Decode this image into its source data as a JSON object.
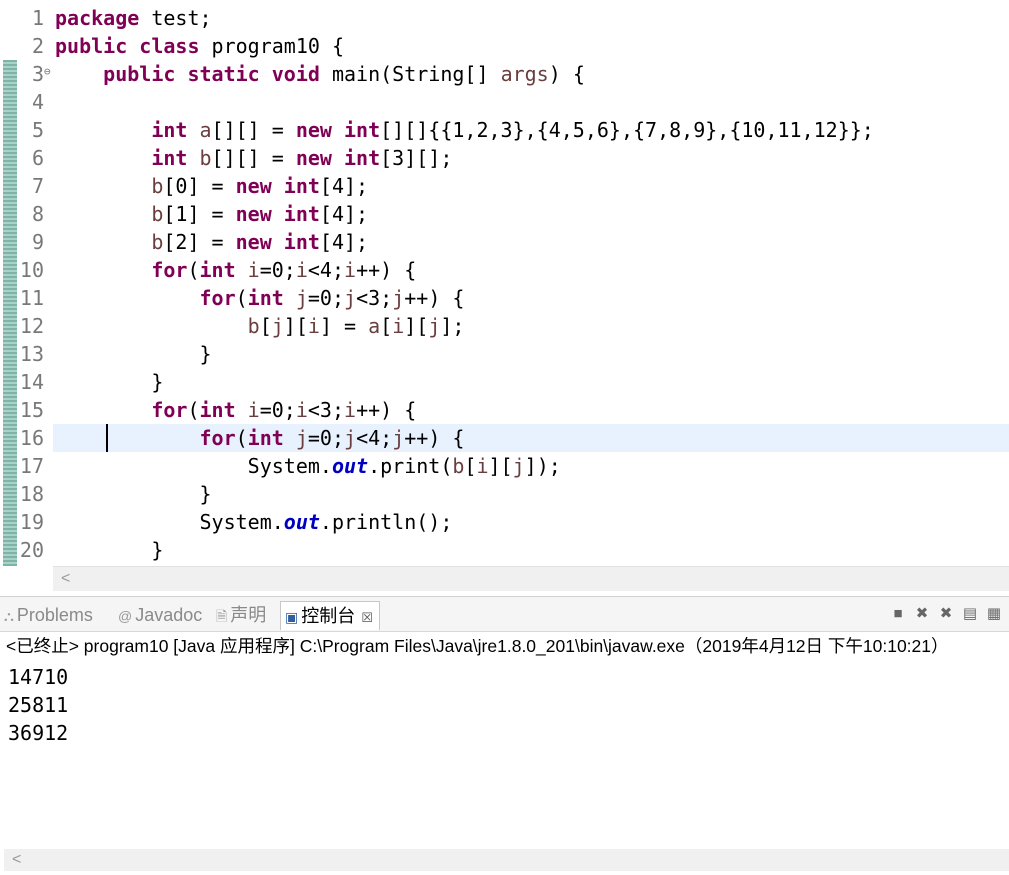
{
  "editor": {
    "lines": [
      {
        "n": "1",
        "tokens": [
          {
            "t": "package",
            "k": "kw"
          },
          {
            "t": " test;"
          }
        ]
      },
      {
        "n": "2",
        "tokens": [
          {
            "t": "public",
            "k": "kw"
          },
          {
            "t": " "
          },
          {
            "t": "class",
            "k": "kw"
          },
          {
            "t": " program10 {"
          }
        ]
      },
      {
        "n": "3",
        "fold": "⊖",
        "tokens": [
          {
            "t": "    "
          },
          {
            "t": "public",
            "k": "kw"
          },
          {
            "t": " "
          },
          {
            "t": "static",
            "k": "kw"
          },
          {
            "t": " "
          },
          {
            "t": "void",
            "k": "kw"
          },
          {
            "t": " main(String[] "
          },
          {
            "t": "args",
            "k": "var"
          },
          {
            "t": ") {"
          }
        ]
      },
      {
        "n": "4",
        "tokens": [
          {
            "t": ""
          }
        ]
      },
      {
        "n": "5",
        "tokens": [
          {
            "t": "        "
          },
          {
            "t": "int",
            "k": "kw"
          },
          {
            "t": " "
          },
          {
            "t": "a",
            "k": "var"
          },
          {
            "t": "[][] = "
          },
          {
            "t": "new",
            "k": "kw"
          },
          {
            "t": " "
          },
          {
            "t": "int",
            "k": "kw"
          },
          {
            "t": "[][]{{1,2,3},{4,5,6},{7,8,9},{10,11,12}};"
          }
        ]
      },
      {
        "n": "6",
        "tokens": [
          {
            "t": "        "
          },
          {
            "t": "int",
            "k": "kw"
          },
          {
            "t": " "
          },
          {
            "t": "b",
            "k": "var"
          },
          {
            "t": "[][] = "
          },
          {
            "t": "new",
            "k": "kw"
          },
          {
            "t": " "
          },
          {
            "t": "int",
            "k": "kw"
          },
          {
            "t": "[3][];"
          }
        ]
      },
      {
        "n": "7",
        "tokens": [
          {
            "t": "        "
          },
          {
            "t": "b",
            "k": "var"
          },
          {
            "t": "[0] = "
          },
          {
            "t": "new",
            "k": "kw"
          },
          {
            "t": " "
          },
          {
            "t": "int",
            "k": "kw"
          },
          {
            "t": "[4];"
          }
        ]
      },
      {
        "n": "8",
        "tokens": [
          {
            "t": "        "
          },
          {
            "t": "b",
            "k": "var"
          },
          {
            "t": "[1] = "
          },
          {
            "t": "new",
            "k": "kw"
          },
          {
            "t": " "
          },
          {
            "t": "int",
            "k": "kw"
          },
          {
            "t": "[4];"
          }
        ]
      },
      {
        "n": "9",
        "tokens": [
          {
            "t": "        "
          },
          {
            "t": "b",
            "k": "var"
          },
          {
            "t": "[2] = "
          },
          {
            "t": "new",
            "k": "kw"
          },
          {
            "t": " "
          },
          {
            "t": "int",
            "k": "kw"
          },
          {
            "t": "[4];"
          }
        ]
      },
      {
        "n": "10",
        "tokens": [
          {
            "t": "        "
          },
          {
            "t": "for",
            "k": "kw"
          },
          {
            "t": "("
          },
          {
            "t": "int",
            "k": "kw"
          },
          {
            "t": " "
          },
          {
            "t": "i",
            "k": "var"
          },
          {
            "t": "=0;"
          },
          {
            "t": "i",
            "k": "var"
          },
          {
            "t": "<4;"
          },
          {
            "t": "i",
            "k": "var"
          },
          {
            "t": "++) {"
          }
        ]
      },
      {
        "n": "11",
        "tokens": [
          {
            "t": "            "
          },
          {
            "t": "for",
            "k": "kw"
          },
          {
            "t": "("
          },
          {
            "t": "int",
            "k": "kw"
          },
          {
            "t": " "
          },
          {
            "t": "j",
            "k": "var"
          },
          {
            "t": "=0;"
          },
          {
            "t": "j",
            "k": "var"
          },
          {
            "t": "<3;"
          },
          {
            "t": "j",
            "k": "var"
          },
          {
            "t": "++) {"
          }
        ]
      },
      {
        "n": "12",
        "tokens": [
          {
            "t": "                "
          },
          {
            "t": "b",
            "k": "var"
          },
          {
            "t": "["
          },
          {
            "t": "j",
            "k": "var"
          },
          {
            "t": "]["
          },
          {
            "t": "i",
            "k": "var"
          },
          {
            "t": "] = "
          },
          {
            "t": "a",
            "k": "var"
          },
          {
            "t": "["
          },
          {
            "t": "i",
            "k": "var"
          },
          {
            "t": "]["
          },
          {
            "t": "j",
            "k": "var"
          },
          {
            "t": "];"
          }
        ]
      },
      {
        "n": "13",
        "tokens": [
          {
            "t": "            }"
          }
        ]
      },
      {
        "n": "14",
        "tokens": [
          {
            "t": "        }"
          }
        ]
      },
      {
        "n": "15",
        "tokens": [
          {
            "t": "        "
          },
          {
            "t": "for",
            "k": "kw"
          },
          {
            "t": "("
          },
          {
            "t": "int",
            "k": "kw"
          },
          {
            "t": " "
          },
          {
            "t": "i",
            "k": "var"
          },
          {
            "t": "=0;"
          },
          {
            "t": "i",
            "k": "var"
          },
          {
            "t": "<3;"
          },
          {
            "t": "i",
            "k": "var"
          },
          {
            "t": "++) {"
          }
        ]
      },
      {
        "n": "16",
        "current": true,
        "tokens": [
          {
            "t": "            "
          },
          {
            "t": "for",
            "k": "kw"
          },
          {
            "t": "("
          },
          {
            "t": "int",
            "k": "kw"
          },
          {
            "t": " "
          },
          {
            "t": "j",
            "k": "var"
          },
          {
            "t": "=0;"
          },
          {
            "t": "j",
            "k": "var"
          },
          {
            "t": "<4;"
          },
          {
            "t": "j",
            "k": "var"
          },
          {
            "t": "++) {"
          }
        ]
      },
      {
        "n": "17",
        "tokens": [
          {
            "t": "                System."
          },
          {
            "t": "out",
            "k": "fld"
          },
          {
            "t": ".print("
          },
          {
            "t": "b",
            "k": "var"
          },
          {
            "t": "["
          },
          {
            "t": "i",
            "k": "var"
          },
          {
            "t": "]["
          },
          {
            "t": "j",
            "k": "var"
          },
          {
            "t": "]);"
          }
        ]
      },
      {
        "n": "18",
        "tokens": [
          {
            "t": "            }"
          }
        ]
      },
      {
        "n": "19",
        "tokens": [
          {
            "t": "            System."
          },
          {
            "t": "out",
            "k": "fld"
          },
          {
            "t": ".println();"
          }
        ]
      },
      {
        "n": "20",
        "tokens": [
          {
            "t": "        }"
          }
        ]
      }
    ],
    "colors": {
      "keyword": "#7f0055",
      "field": "#0000c0",
      "variable": "#6a3e3e",
      "current_line": "#e8f2fe"
    }
  },
  "panel": {
    "tabs": [
      {
        "label": "Problems",
        "icon": "problems-icon",
        "glyph": "⛬"
      },
      {
        "label": "Javadoc",
        "icon": "javadoc-icon",
        "glyph": "@"
      },
      {
        "label": "声明",
        "icon": "declaration-icon",
        "glyph": "🗎"
      },
      {
        "label": "控制台",
        "icon": "console-icon",
        "glyph": "▣",
        "active": true
      }
    ],
    "close_glyph": "☒",
    "tools": [
      {
        "name": "terminate-icon",
        "glyph": "■"
      },
      {
        "name": "remove-launch-icon",
        "glyph": "✖"
      },
      {
        "name": "remove-all-terminated-icon",
        "glyph": "✖"
      },
      {
        "name": "clear-console-icon",
        "glyph": "▤"
      },
      {
        "name": "scroll-lock-icon",
        "glyph": "▦"
      }
    ],
    "status": "<已终止> program10 [Java 应用程序] C:\\Program Files\\Java\\jre1.8.0_201\\bin\\javaw.exe（2019年4月12日 下午10:10:21）",
    "output": [
      "14710",
      "25811",
      "36912"
    ]
  },
  "scroll_glyph": "<"
}
